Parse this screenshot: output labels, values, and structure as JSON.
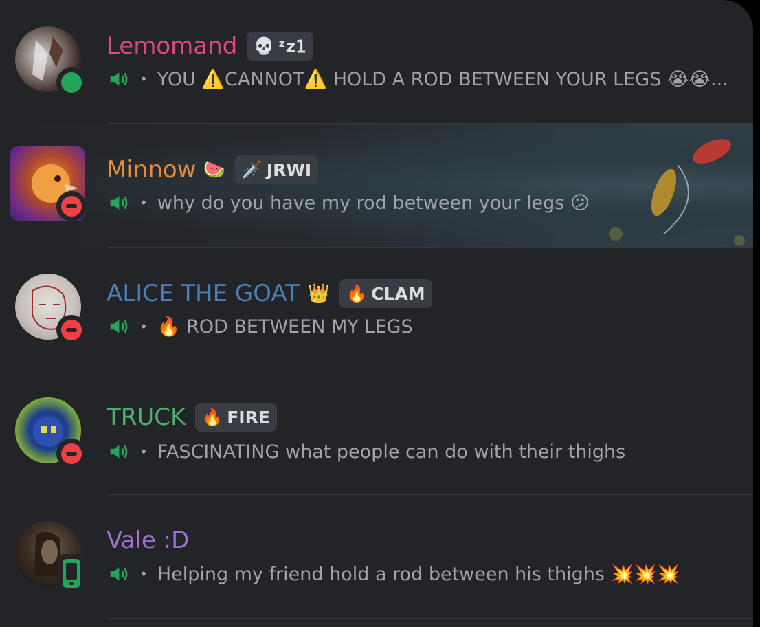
{
  "members": [
    {
      "name": "Lemomand",
      "name_color": "#e0497a",
      "name_emoji": "",
      "tag_icon": "💀",
      "tag_text": "ᶻz𝟣",
      "status": "online",
      "activity": "YOU ⚠️CANNOT⚠️ HOLD A ROD BETWEEN YOUR LEGS 😭😭...",
      "activity_icon": "speaker-icon"
    },
    {
      "name": "Minnow",
      "name_color": "#e88b3a",
      "name_emoji": "🍉",
      "tag_icon": "🗡️",
      "tag_text": "JRWI",
      "status": "dnd",
      "activity": "why do you have my rod between your legs 😕",
      "activity_icon": "speaker-icon"
    },
    {
      "name": "ALICE THE GOAT",
      "name_color": "#4a7fb8",
      "name_emoji": "👑",
      "tag_icon": "🔥",
      "tag_text": "CLAM",
      "status": "dnd",
      "activity": "🔥  ROD BETWEEN MY LEGS",
      "activity_icon": "speaker-icon"
    },
    {
      "name": "TRUCK",
      "name_color": "#4caf6d",
      "name_emoji": "",
      "tag_icon": "🔥",
      "tag_text": "FIRE",
      "status": "dnd",
      "activity": "FASCINATING what people can do with their thighs",
      "activity_icon": "speaker-icon"
    },
    {
      "name": "Vale :D",
      "name_color": "#a06fd0",
      "name_emoji": "",
      "tag_icon": "",
      "tag_text": "",
      "status": "mobile",
      "activity": "Helping my friend hold a rod between his thighs 💥💥💥",
      "activity_icon": "speaker-icon"
    }
  ],
  "colors": {
    "background": "#232428",
    "online": "#23a55a",
    "dnd": "#f23f43",
    "muted_text": "#a0a3a9"
  }
}
